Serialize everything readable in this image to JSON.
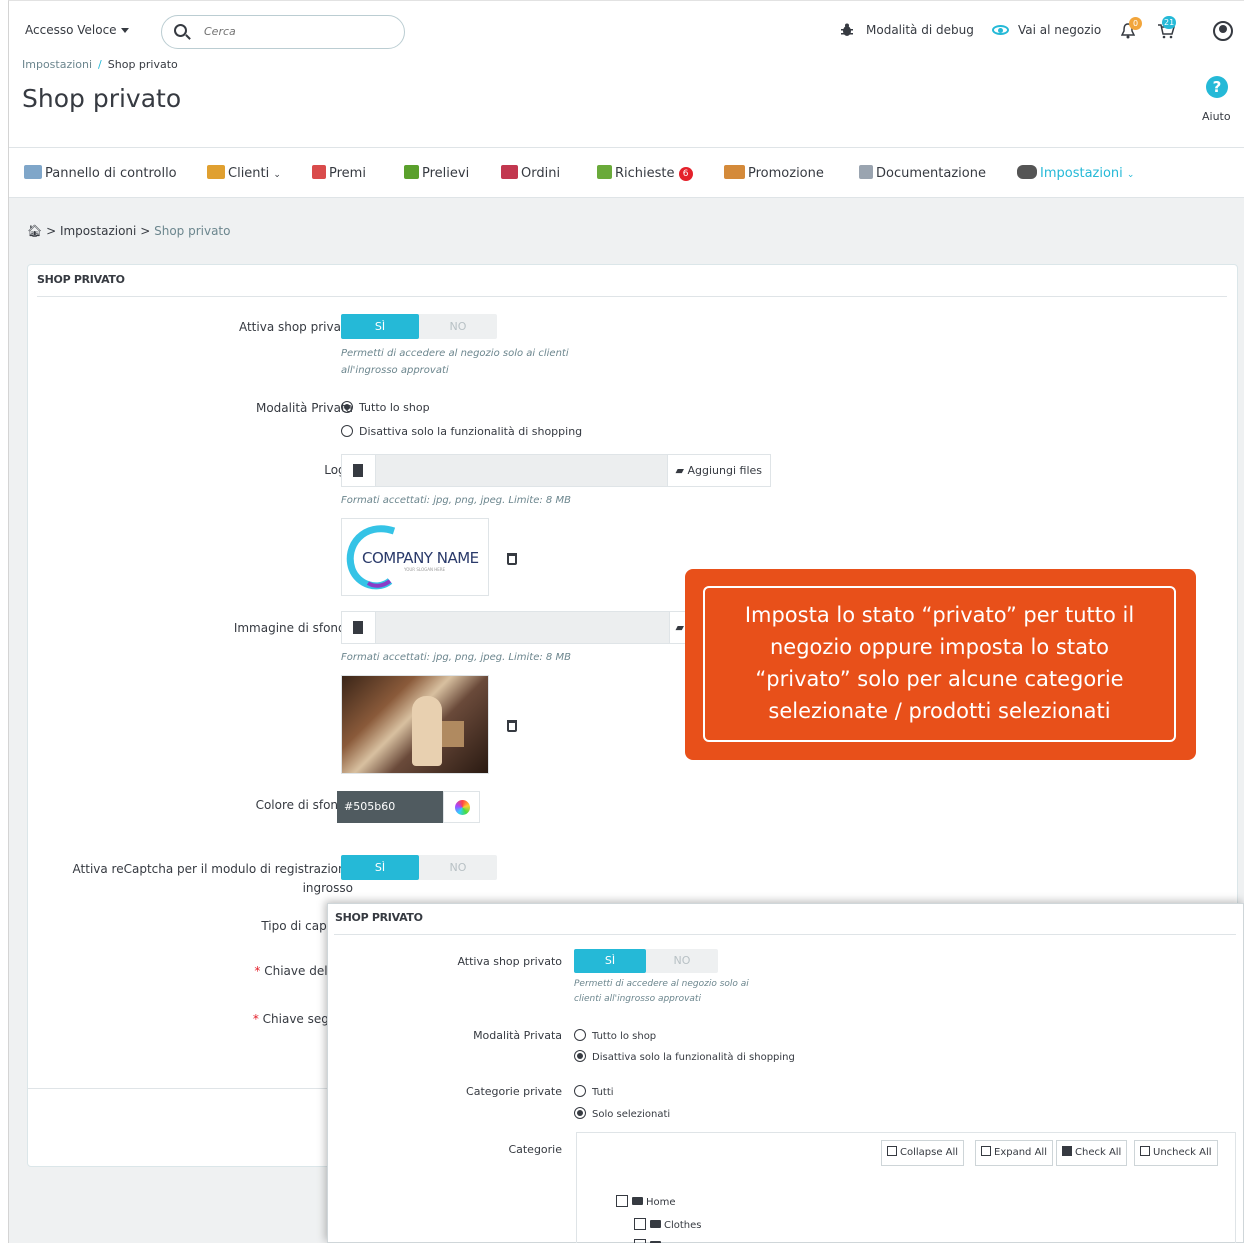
{
  "topbar": {
    "quick_access": "Accesso Veloce",
    "search_placeholder": "Cerca",
    "debug_label": "Modalità di debug",
    "shop_link": "Vai al negozio",
    "notif_badge": "0",
    "orders_badge": "21"
  },
  "header": {
    "breadcrumb_parent": "Impostazioni",
    "breadcrumb_sep": "/",
    "breadcrumb_current": "Shop privato",
    "title": "Shop privato",
    "help": "Aiuto"
  },
  "nav": {
    "items": [
      {
        "label": "Pannello di controllo",
        "icon": "dashboard-icon",
        "color": "#7fa6c9"
      },
      {
        "label": "Clienti",
        "icon": "customers-icon",
        "color": "#e0a030"
      },
      {
        "label": "Premi",
        "icon": "rewards-icon",
        "color": "#d94b4b"
      },
      {
        "label": "Prelievi",
        "icon": "withdrawals-icon",
        "color": "#5aa02c"
      },
      {
        "label": "Ordini",
        "icon": "cart-icon",
        "color": "#c2374f"
      },
      {
        "label": "Richieste",
        "icon": "requests-icon",
        "color": "#6aaa3a",
        "badge": "6"
      },
      {
        "label": "Promozione",
        "icon": "promotion-icon",
        "color": "#d48a3a"
      },
      {
        "label": "Documentazione",
        "icon": "docs-icon",
        "color": "#9aa4b0"
      },
      {
        "label": "Impostazioni",
        "icon": "gears-icon",
        "color": "#555555",
        "active": true
      }
    ]
  },
  "crumb2": {
    "parent": "Impostazioni",
    "current": "Shop privato",
    "sep": ">"
  },
  "form": {
    "panel_title": "SHOP PRIVATO",
    "enable_label": "Attiva shop privato",
    "yes": "SÌ",
    "no": "NO",
    "enable_hint_1": "Permetti di accedere al negozio solo ai clienti",
    "enable_hint_2": "all'ingrosso approvati",
    "mode_label": "Modalità Privata",
    "mode_opt1": "Tutto lo shop",
    "mode_opt2": "Disattiva solo la funzionalità di shopping",
    "logo_label": "Logo",
    "add_files": "Aggiungi files",
    "formats_hint": "Formati accettati: jpg, png, jpeg. Limite: 8 MB",
    "logo_text": "COMPANY NAME",
    "logo_slogan": "YOUR SLOGAN HERE",
    "bg_image_label": "Immagine di sfondo",
    "bg_color_label": "Colore di sfondo",
    "bg_color_value": "#505b60",
    "recaptcha_label_1": "Attiva reCaptcha per il modulo di registrazione",
    "recaptcha_label_2": "ingrosso",
    "captcha_type_label": "Tipo di captcha",
    "site_key_label": "Chiave del sito",
    "secret_key_label": "Chiave segreta",
    "required_mark": "*"
  },
  "callout": {
    "text_1": "Imposta lo stato “privato” per tutto il",
    "text_2": "negozio oppure imposta lo stato",
    "text_3": "“privato” solo per alcune categorie",
    "text_4": "selezionate / prodotti selezionati",
    "color": "#e8501a"
  },
  "overlay": {
    "title": "SHOP PRIVATO",
    "enable_label": "Attiva shop privato",
    "yes": "SÌ",
    "no": "NO",
    "hint_1": "Permetti di accedere al negozio solo ai",
    "hint_2": "clienti all'ingrosso approvati",
    "mode_label": "Modalità Privata",
    "mode_opt1": "Tutto lo shop",
    "mode_opt2": "Disattiva solo la funzionalità di shopping",
    "cat_private_label": "Categorie private",
    "cat_opt1": "Tutti",
    "cat_opt2": "Solo selezionati",
    "categories_label": "Categorie",
    "collapse_all": "Collapse All",
    "expand_all": "Expand All",
    "check_all": "Check All",
    "uncheck_all": "Uncheck All",
    "tree_home": "Home",
    "tree_clothes": "Clothes"
  },
  "colors": {
    "accent": "#25b9d7",
    "switch_on": "#25b9d7",
    "danger": "#e4202a"
  }
}
